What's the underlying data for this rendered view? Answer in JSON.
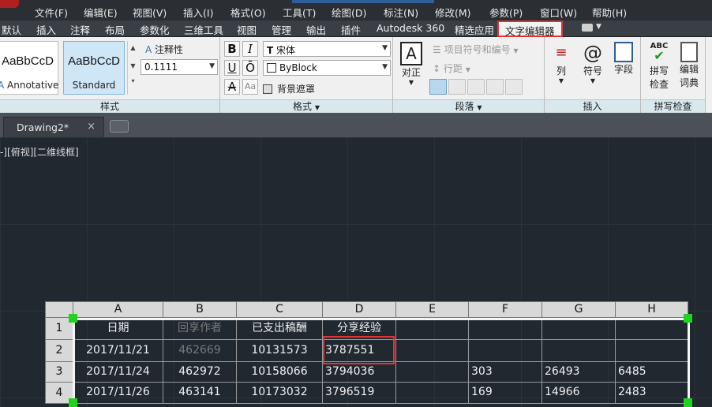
{
  "menu": [
    "文件(F)",
    "编辑(E)",
    "视图(V)",
    "插入(I)",
    "格式(O)",
    "工具(T)",
    "绘图(D)",
    "标注(N)",
    "修改(M)",
    "参数(P)",
    "窗口(W)",
    "帮助(H)"
  ],
  "tabs": [
    "默认",
    "插入",
    "注释",
    "布局",
    "参数化",
    "三维工具",
    "视图",
    "管理",
    "输出",
    "插件",
    "Autodesk 360",
    "精选应用",
    "文字编辑器"
  ],
  "active_tab": "文字编辑器",
  "ribbon": {
    "style_panel": {
      "title": "样式",
      "styles": [
        {
          "sample": "AaBbCcD",
          "name": "Annotative"
        },
        {
          "sample": "AaBbCcD",
          "name": "Standard"
        }
      ],
      "annotative_label": "注释性",
      "height_value": "0.1111"
    },
    "format_panel": {
      "title": "格式",
      "bold": "B",
      "italic": "I",
      "underline": "U",
      "overline": "Ō",
      "strike": "A",
      "case": "Aa",
      "font_value": "宋体",
      "font_prefix": "T",
      "color_value": "ByBlock",
      "mask_label": "背景遮罩"
    },
    "paragraph_panel": {
      "title": "段落",
      "justify_label": "对正",
      "bullets_label": "项目符号和编号",
      "line_spacing_label": "行距"
    },
    "insert_panel": {
      "title": "插入",
      "columns_label": "列",
      "symbol_label": "符号",
      "field_label": "字段"
    },
    "spell_panel": {
      "title": "拼写检查",
      "spell_label_1": "拼写",
      "spell_label_2": "检查",
      "dict_label_1": "编辑",
      "dict_label_2": "词典"
    }
  },
  "file_tab": {
    "name": "Drawing2*",
    "close": "×"
  },
  "view_label": "-][俯视][二维线框]",
  "table": {
    "columns": [
      "A",
      "B",
      "C",
      "D",
      "E",
      "F",
      "G",
      "H"
    ],
    "row_numbers": [
      "1",
      "2",
      "3",
      "4"
    ],
    "rows": [
      [
        "日期",
        "回享作者",
        "已支出稿酬",
        "分享经验",
        "",
        "",
        "",
        ""
      ],
      [
        "2017/11/21",
        "462669",
        "10131573",
        "3787551",
        "",
        "",
        "",
        ""
      ],
      [
        "2017/11/24",
        "462972",
        "10158066",
        "3794036",
        "",
        "303",
        "26493",
        "6485"
      ],
      [
        "2017/11/26",
        "463141",
        "10173032",
        "3796519",
        "",
        "169",
        "14966",
        "2483"
      ]
    ]
  },
  "colors": {
    "highlight": "#e03535",
    "grip": "#21d321",
    "canvas": "#212830"
  }
}
